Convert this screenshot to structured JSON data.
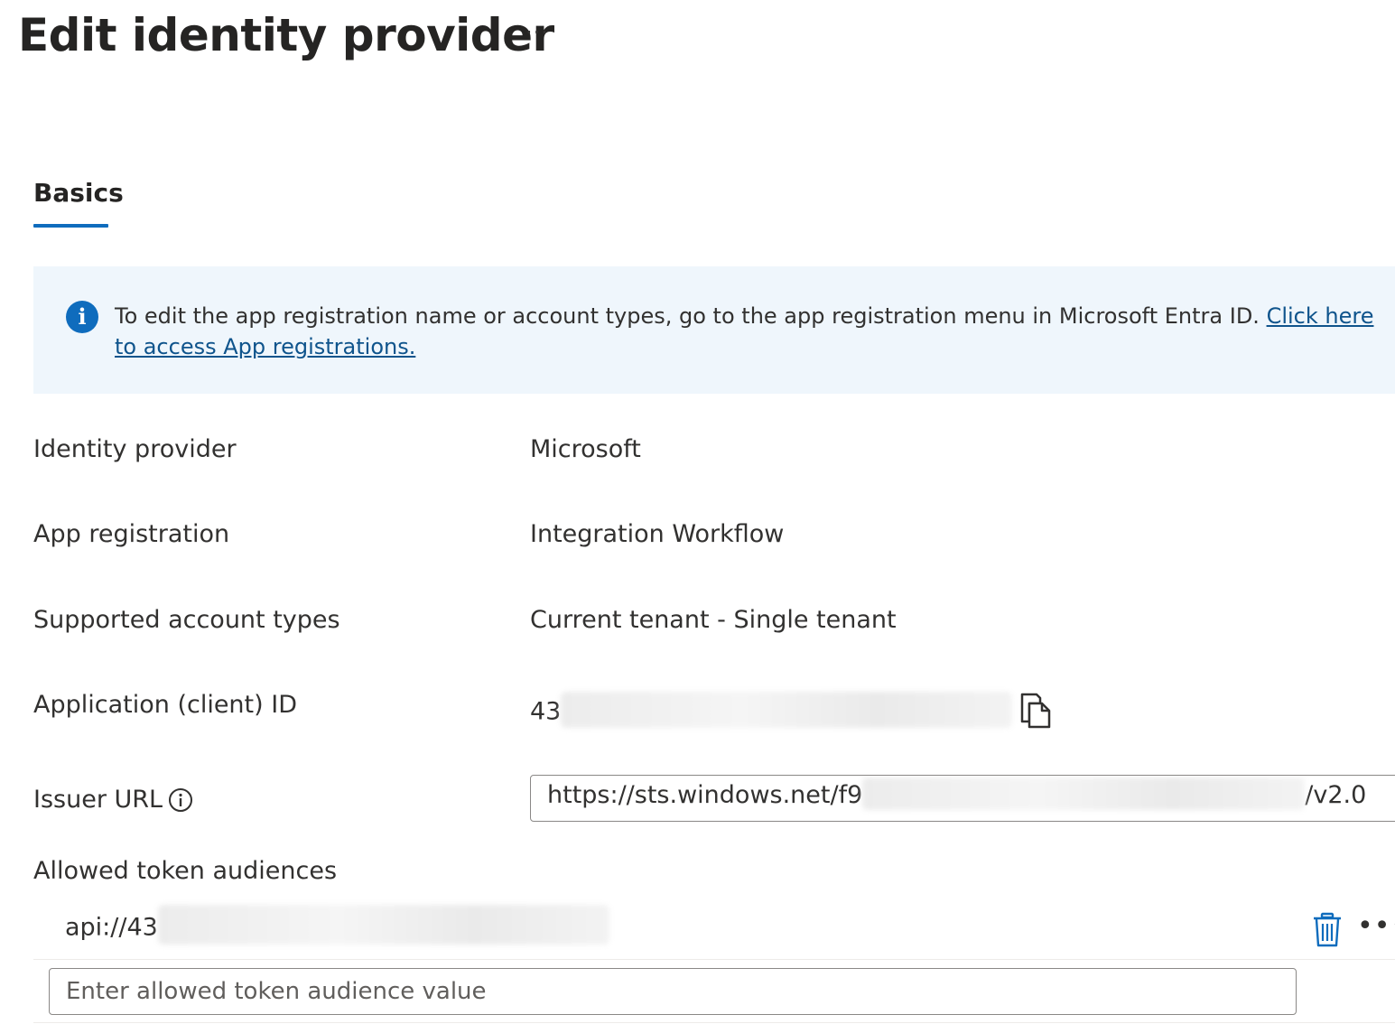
{
  "header": {
    "title": "Edit identity provider",
    "more_label": "···"
  },
  "tabs": [
    {
      "label": "Basics",
      "selected": true
    }
  ],
  "info_bar": {
    "text": "To edit the app registration name or account types, go to the app registration menu in Microsoft Entra ID. ",
    "link_text": "Click here to access App registrations.",
    "icon": "info-icon"
  },
  "fields": {
    "identity_provider": {
      "label": "Identity provider",
      "value": "Microsoft"
    },
    "app_registration": {
      "label": "App registration",
      "value": "Integration Workflow"
    },
    "account_types": {
      "label": "Supported account types",
      "value": "Current tenant - Single tenant"
    },
    "client_id": {
      "label": "Application (client) ID",
      "value_prefix": "43",
      "icon": "copy-icon"
    },
    "issuer_url": {
      "label": "Issuer URL",
      "value_prefix": "https://sts.windows.net/f9",
      "value_suffix": "/v2.0",
      "icon": "info-icon"
    }
  },
  "audiences": {
    "label": "Allowed token audiences",
    "items": [
      {
        "value_prefix": "api://43",
        "delete_icon": "trash-icon",
        "more_label": "•••"
      }
    ],
    "input_placeholder": "Enter allowed token audience value"
  },
  "colors": {
    "accent": "#0f6cbd",
    "info_background": "#eff6fc",
    "link": "#0f548c"
  }
}
